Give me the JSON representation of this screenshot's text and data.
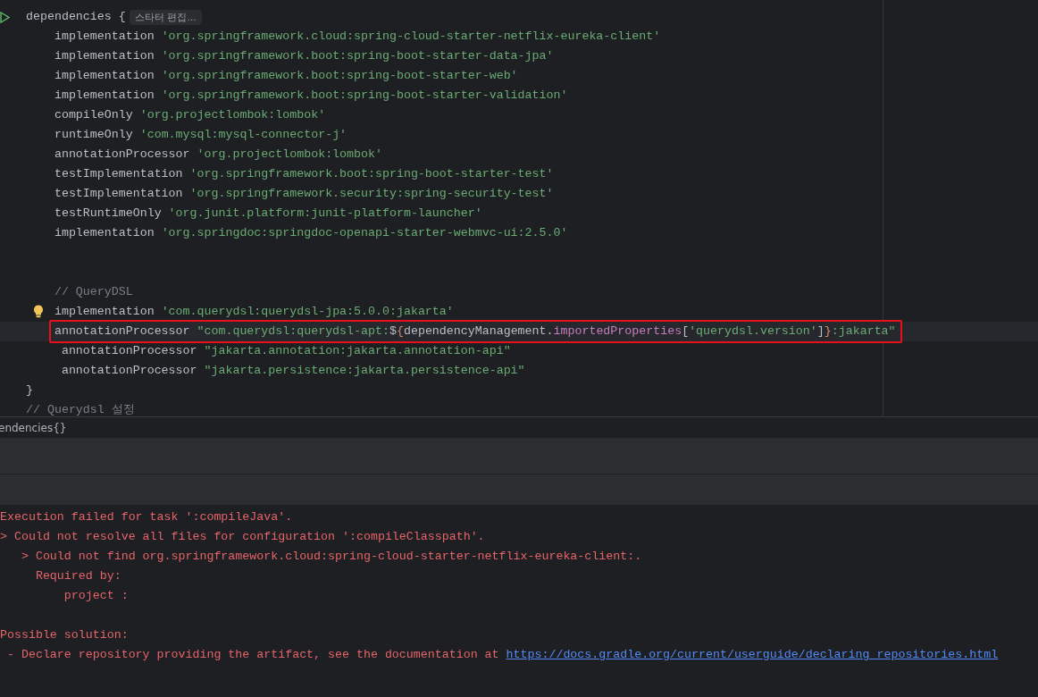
{
  "editor": {
    "lines": [
      {
        "kind": "code",
        "tokens": [
          {
            "kind": "plain",
            "text": "dependencies {"
          }
        ],
        "run_gutter": true,
        "inlay_hint": "스타터 편집..."
      },
      {
        "kind": "code",
        "tokens": [
          {
            "kind": "plain",
            "text": "    implementation "
          },
          {
            "kind": "string",
            "text": "'org.springframework.cloud:spring-cloud-starter-netflix-eureka-client'"
          }
        ]
      },
      {
        "kind": "code",
        "tokens": [
          {
            "kind": "plain",
            "text": "    implementation "
          },
          {
            "kind": "string",
            "text": "'org.springframework.boot:spring-boot-starter-data-jpa'"
          }
        ]
      },
      {
        "kind": "code",
        "tokens": [
          {
            "kind": "plain",
            "text": "    implementation "
          },
          {
            "kind": "string",
            "text": "'org.springframework.boot:spring-boot-starter-web'"
          }
        ]
      },
      {
        "kind": "code",
        "tokens": [
          {
            "kind": "plain",
            "text": "    implementation "
          },
          {
            "kind": "string",
            "text": "'org.springframework.boot:spring-boot-starter-validation'"
          }
        ]
      },
      {
        "kind": "code",
        "tokens": [
          {
            "kind": "plain",
            "text": "    compileOnly "
          },
          {
            "kind": "string",
            "text": "'org.projectlombok:lombok'"
          }
        ]
      },
      {
        "kind": "code",
        "tokens": [
          {
            "kind": "plain",
            "text": "    runtimeOnly "
          },
          {
            "kind": "string",
            "text": "'com.mysql:mysql-connector-j'"
          }
        ]
      },
      {
        "kind": "code",
        "tokens": [
          {
            "kind": "plain",
            "text": "    annotationProcessor "
          },
          {
            "kind": "string",
            "text": "'org.projectlombok:lombok'"
          }
        ]
      },
      {
        "kind": "code",
        "tokens": [
          {
            "kind": "plain",
            "text": "    testImplementation "
          },
          {
            "kind": "string",
            "text": "'org.springframework.boot:spring-boot-starter-test'"
          }
        ]
      },
      {
        "kind": "code",
        "tokens": [
          {
            "kind": "plain",
            "text": "    testImplementation "
          },
          {
            "kind": "string",
            "text": "'org.springframework.security:spring-security-test'"
          }
        ]
      },
      {
        "kind": "code",
        "tokens": [
          {
            "kind": "plain",
            "text": "    testRuntimeOnly "
          },
          {
            "kind": "string",
            "text": "'org.junit.platform:junit-platform-launcher'"
          }
        ]
      },
      {
        "kind": "code",
        "tokens": [
          {
            "kind": "plain",
            "text": "    implementation "
          },
          {
            "kind": "string",
            "text": "'org.springdoc:springdoc-openapi-starter-webmvc-ui:2.5.0'"
          }
        ]
      },
      {
        "kind": "blank"
      },
      {
        "kind": "blank"
      },
      {
        "kind": "code",
        "tokens": [
          {
            "kind": "comment",
            "text": "    // QueryDSL"
          }
        ]
      },
      {
        "kind": "code",
        "tokens": [
          {
            "kind": "plain",
            "text": "    implementation "
          },
          {
            "kind": "string",
            "text": "'com.querydsl:querydsl-jpa:5.0.0:jakarta'"
          }
        ],
        "bulb": true
      },
      {
        "kind": "code",
        "tokens": [
          {
            "kind": "plain",
            "text": "    annotationProcessor "
          },
          {
            "kind": "string",
            "text": "\"com.querydsl:querydsl-apt:"
          },
          {
            "kind": "plain",
            "text": "$"
          },
          {
            "kind": "brace",
            "text": "{"
          },
          {
            "kind": "plain",
            "text": "dependencyManagement."
          },
          {
            "kind": "method",
            "text": "importedProperties"
          },
          {
            "kind": "plain",
            "text": "["
          },
          {
            "kind": "string",
            "text": "'querydsl.version'"
          },
          {
            "kind": "plain",
            "text": "]"
          },
          {
            "kind": "brace",
            "text": "}"
          },
          {
            "kind": "string",
            "text": ":jakarta\""
          }
        ],
        "boxed": true
      },
      {
        "kind": "code",
        "tokens": [
          {
            "kind": "plain",
            "text": "     annotationProcessor "
          },
          {
            "kind": "string",
            "text": "\"jakarta.annotation:jakarta.annotation-api\""
          }
        ]
      },
      {
        "kind": "code",
        "tokens": [
          {
            "kind": "plain",
            "text": "     annotationProcessor "
          },
          {
            "kind": "string",
            "text": "\"jakarta.persistence:jakarta.persistence-api\""
          }
        ]
      },
      {
        "kind": "code",
        "tokens": [
          {
            "kind": "plain",
            "text": "}"
          }
        ]
      },
      {
        "kind": "code",
        "tokens": [
          {
            "kind": "comment",
            "text": "// Querydsl 설정"
          }
        ]
      }
    ]
  },
  "breadcrumb": "endencies{}",
  "output": [
    {
      "kind": "text",
      "text": "Execution failed for task ':compileJava'."
    },
    {
      "kind": "text",
      "text": "> Could not resolve all files for configuration ':compileClasspath'."
    },
    {
      "kind": "text",
      "text": "   > Could not find org.springframework.cloud:spring-cloud-starter-netflix-eureka-client:."
    },
    {
      "kind": "text",
      "text": "     Required by:"
    },
    {
      "kind": "text",
      "text": "         project :"
    },
    {
      "kind": "blank"
    },
    {
      "kind": "text",
      "text": "Possible solution:"
    },
    {
      "kind": "text",
      "text": " - Declare repository providing the artifact, see the documentation at ",
      "link": "https://docs.gradle.org/current/userguide/declaring_repositories.html"
    }
  ]
}
